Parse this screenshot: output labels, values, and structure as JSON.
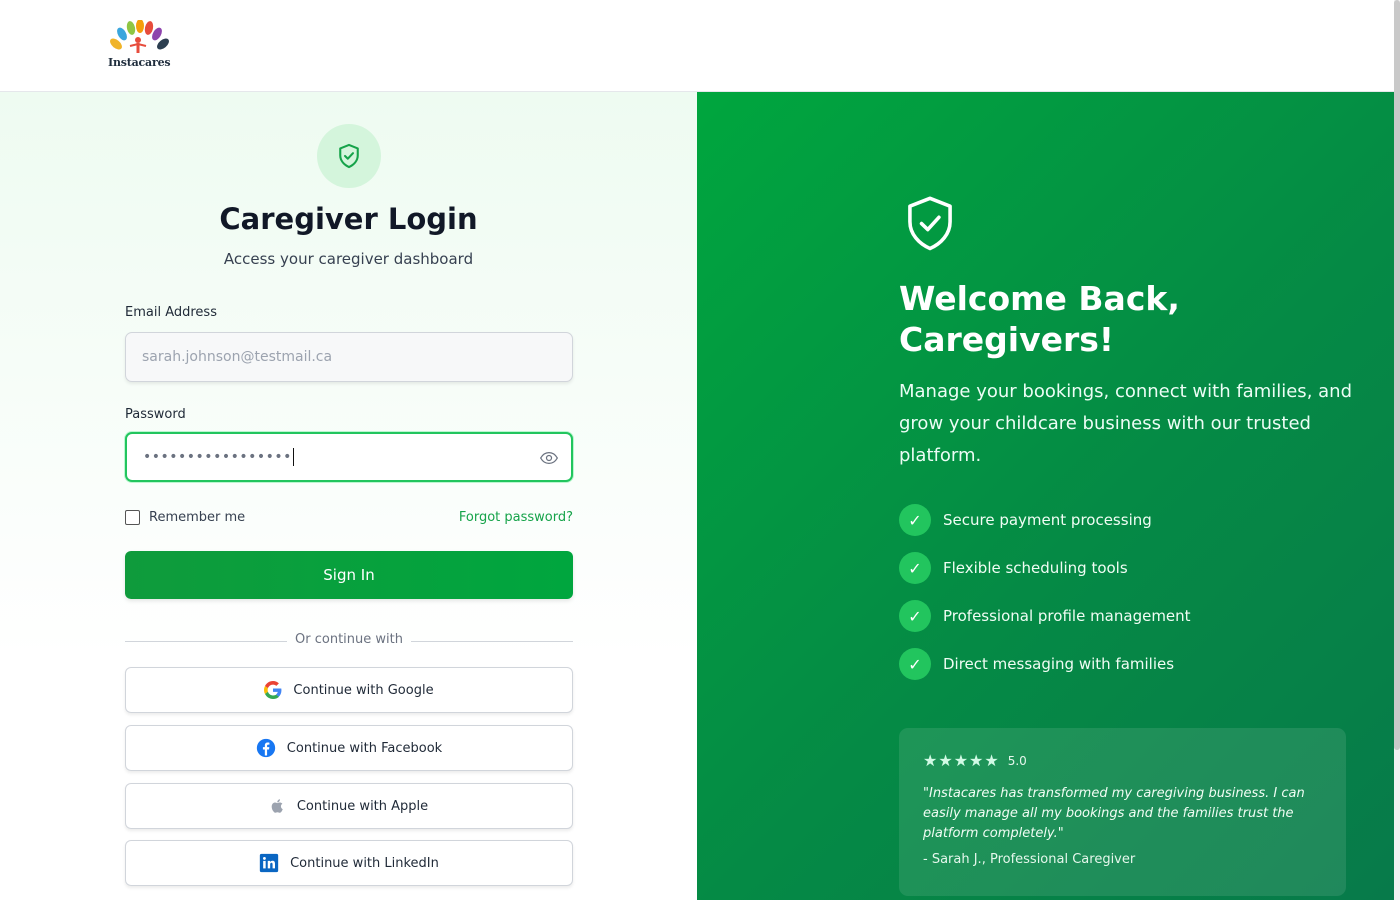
{
  "header": {
    "logo_text": "Instacares"
  },
  "login": {
    "title": "Caregiver Login",
    "subtitle": "Access your caregiver dashboard",
    "email_label": "Email Address",
    "email_placeholder": "sarah.johnson@testmail.ca",
    "password_label": "Password",
    "password_value": "•••••••••••••••••",
    "remember_label": "Remember me",
    "forgot_label": "Forgot password?",
    "signin_label": "Sign In",
    "divider_text": "Or continue with",
    "social": [
      {
        "label": "Continue with Google",
        "icon": "google-icon"
      },
      {
        "label": "Continue with Facebook",
        "icon": "facebook-icon"
      },
      {
        "label": "Continue with Apple",
        "icon": "apple-icon"
      },
      {
        "label": "Continue with LinkedIn",
        "icon": "linkedin-icon"
      }
    ]
  },
  "promo": {
    "title_line1": "Welcome Back,",
    "title_line2": "Caregivers!",
    "description": "Manage your bookings, connect with families, and grow your childcare business with our trusted platform.",
    "features": [
      "Secure payment processing",
      "Flexible scheduling tools",
      "Professional profile management",
      "Direct messaging with families"
    ],
    "testimonial": {
      "stars": 5,
      "rating": "5.0",
      "quote": "\"Instacares has transformed my caregiving business. I can easily manage all my bookings and the families trust the platform completely.\"",
      "author": "- Sarah J., Professional Caregiver"
    }
  },
  "colors": {
    "accent": "#00a63e",
    "accent_light": "#22c55e",
    "badge_bg": "#d4f5dc"
  }
}
